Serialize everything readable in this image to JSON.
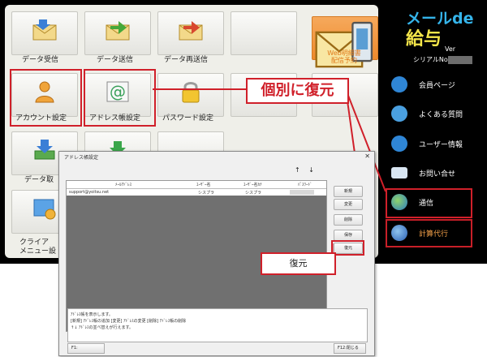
{
  "main": {
    "tiles": {
      "data_receive": "データ受信",
      "data_send": "データ送信",
      "data_resend": "データ再送信",
      "web_statement": "Web明細書\n配信予約",
      "account_settings": "アカウント設定",
      "address_book": "アドレス帳設定",
      "password_settings": "パスワード設定",
      "data_partial": "データ取",
      "client_partial": "クライア\nメニュー設"
    },
    "callout": "個別に復元"
  },
  "brand": {
    "title_line1": "メールde",
    "title_line2": "給与",
    "version_label": "Ver",
    "serial_label": "シリアルNo"
  },
  "sidebar": {
    "items": [
      {
        "label": "会員ページ",
        "icon": "person-icon"
      },
      {
        "label": "よくある質問",
        "icon": "question-icon"
      },
      {
        "label": "ユーザー情報",
        "icon": "info-icon"
      },
      {
        "label": "お問い合せ",
        "icon": "mail-icon"
      },
      {
        "label": "通信",
        "icon": "globe-icon"
      },
      {
        "label": "計算代行",
        "icon": "globe-icon"
      }
    ]
  },
  "dialog": {
    "title": "アドレス帳設定",
    "close_glyph": "✕",
    "columns": [
      "ﾒｰﾙｱﾄﾞﾚｽ",
      "ﾕｰｻﾞｰ名",
      "ﾕｰｻﾞｰ名ｶﾅ",
      "ﾊﾟｽﾜｰﾄﾞ"
    ],
    "rows": [
      {
        "email": "support@yoitsu.net",
        "user": "シスプラ",
        "user_kana": "シスプラ",
        "password": ""
      }
    ],
    "sort_arrows": "↑ ↓",
    "buttons": [
      "新規",
      "変更",
      "削除",
      "保存",
      "復元"
    ],
    "restore_callout": "復元",
    "status_lines": [
      "ｱﾄﾞﾚｽ帳を表示します。",
      "[新規] ｱﾄﾞﾚｽ帳の追加 [変更] ｱﾄﾞﾚｽの変更 [削除] ｱﾄﾞﾚｽ帳の削除",
      "↑↓ ｱﾄﾞﾚｽの並べ替えが行えます。"
    ],
    "footer_left": "F1:",
    "footer_right": "F12:閉じる"
  },
  "colors": {
    "highlight": "#d0202a",
    "brand_blue": "#35b4ea",
    "brand_yellow": "#f4e64a",
    "web_tile": "#ee8a2c"
  }
}
